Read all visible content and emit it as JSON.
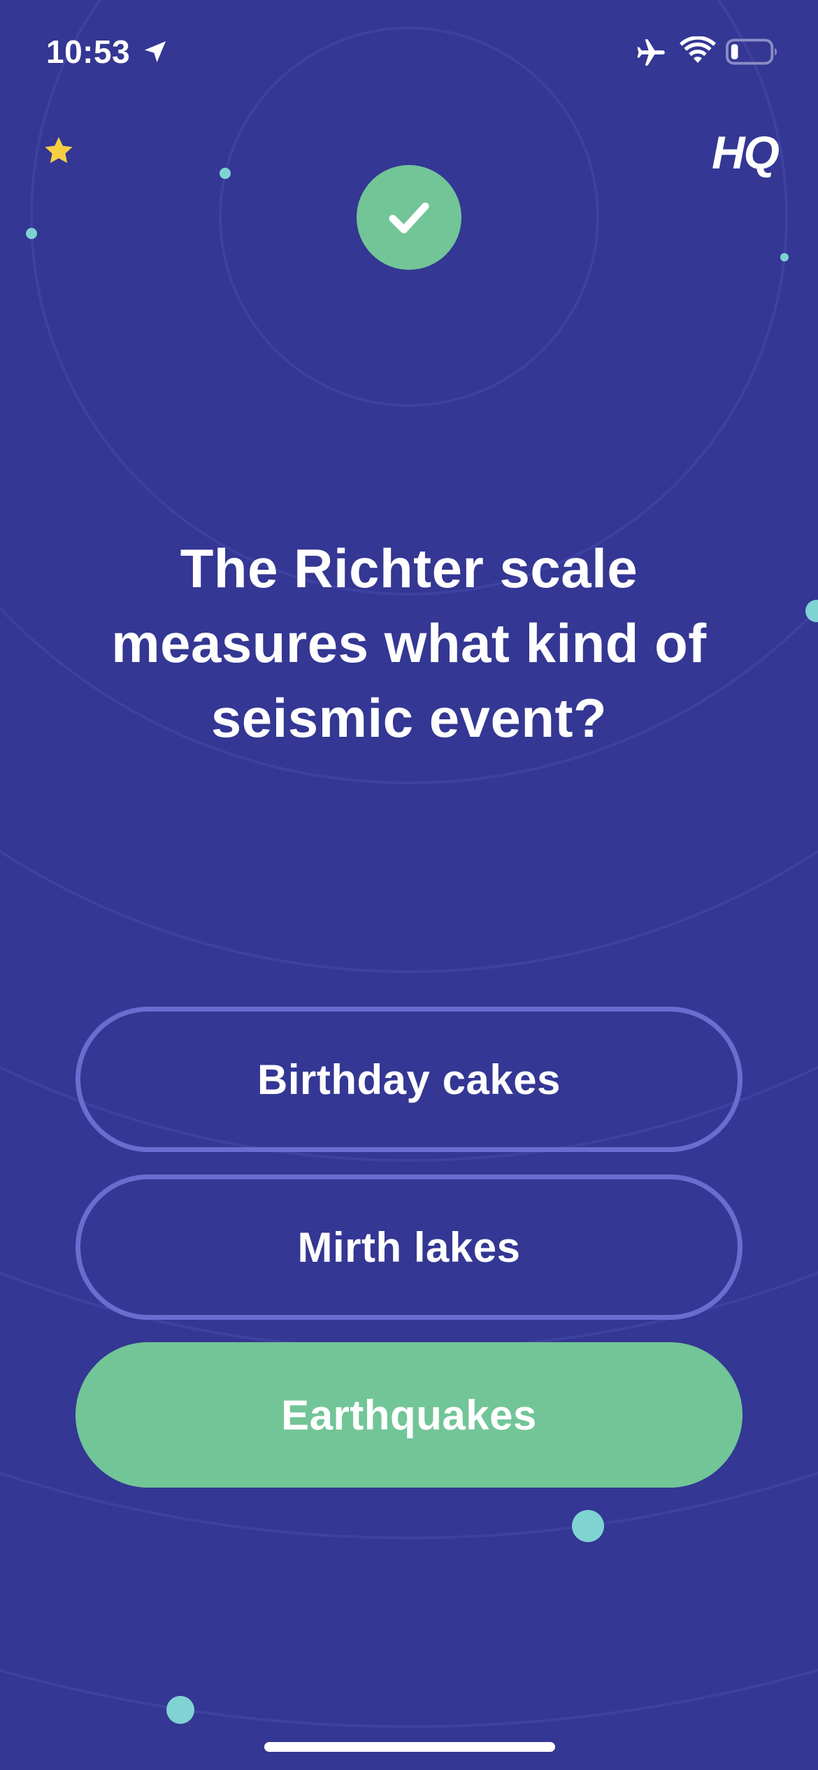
{
  "status_bar": {
    "time": "10:53",
    "icons": [
      "location-arrow-icon",
      "airplane-icon",
      "wifi-icon",
      "battery-low-icon"
    ]
  },
  "header": {
    "logo": "HQ",
    "star_icon": "star-icon"
  },
  "result": {
    "icon": "check-icon",
    "color": "#72c597"
  },
  "question": {
    "text": "The Richter scale measures what kind of seismic event?"
  },
  "answers": [
    {
      "label": "Birthday cakes",
      "correct": false
    },
    {
      "label": "Mirth lakes",
      "correct": false
    },
    {
      "label": "Earthquakes",
      "correct": true
    }
  ],
  "colors": {
    "background": "#343793",
    "correct": "#72c597",
    "answer_border": "#6a6ccf",
    "accent_dot": "#7fd3d3",
    "star": "#f6d043"
  }
}
